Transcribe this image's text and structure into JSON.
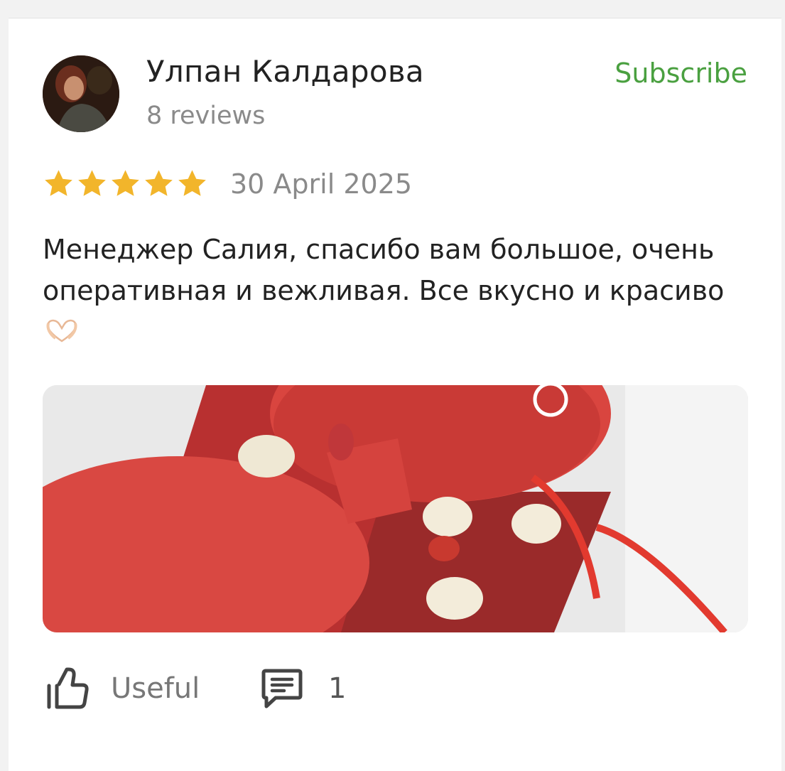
{
  "review": {
    "author": {
      "name": "Улпан Калдарова",
      "reviews_count": "8 reviews"
    },
    "subscribe_label": "Subscribe",
    "rating": {
      "value": 5,
      "max": 5
    },
    "date": "30 April 2025",
    "text": "Менеджер Салия, спасибо вам большое, очень оперативная и вежливая. Все вкусно и красиво",
    "photo_icon": "review-photo"
  },
  "actions": {
    "useful_label": "Useful",
    "comments_count": "1"
  },
  "colors": {
    "accent_green": "#4aa040",
    "star_gold": "#f2b52b",
    "text_primary": "#222222",
    "text_secondary": "#8a8a8a"
  }
}
